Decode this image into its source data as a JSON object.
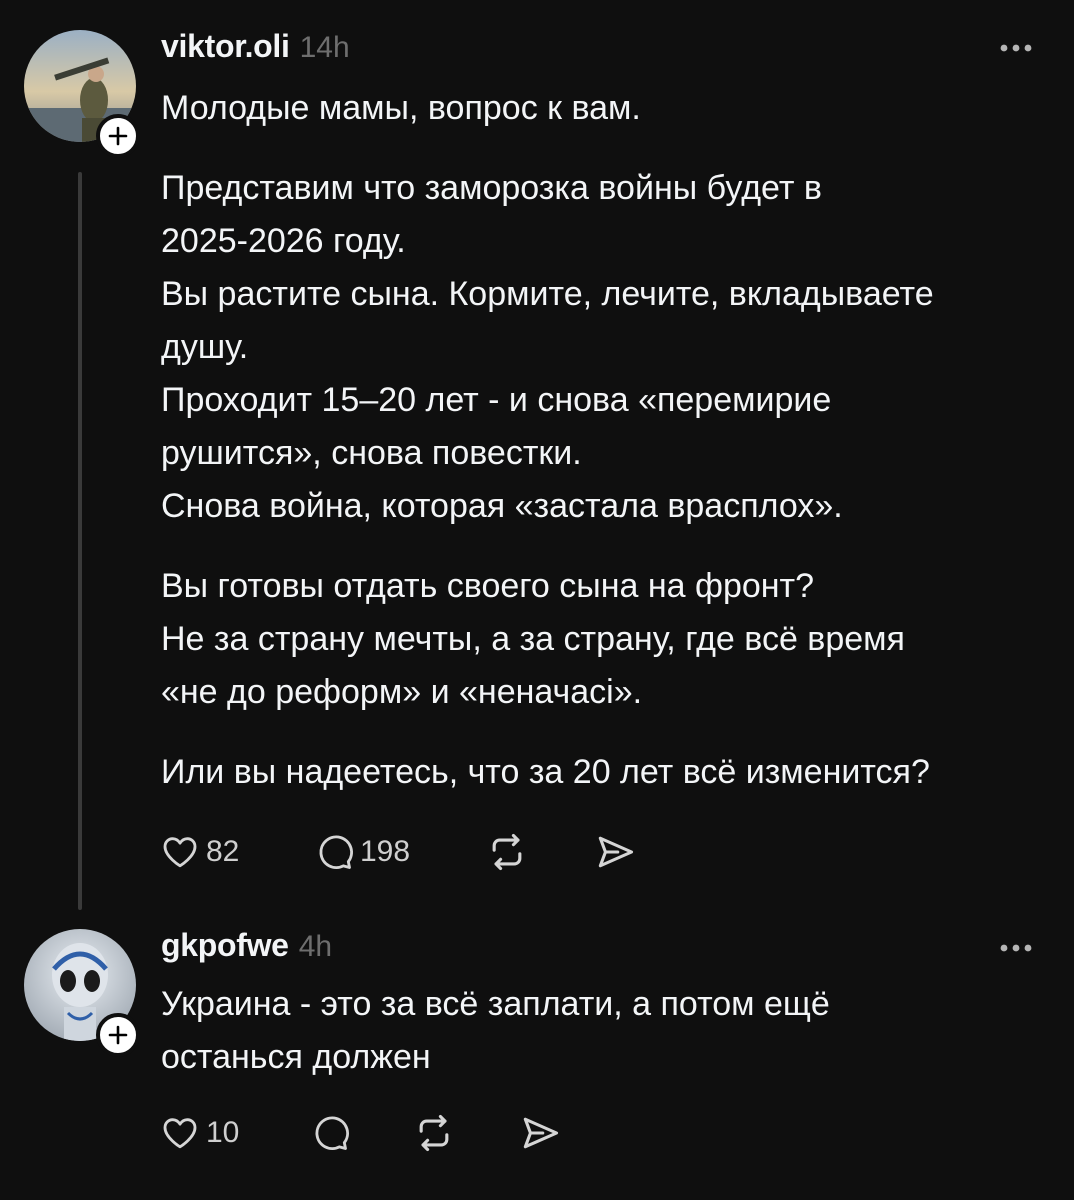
{
  "posts": [
    {
      "username": "viktor.oli",
      "time": "14h",
      "paragraphs": [
        [
          "Молодые мамы, вопрос к вам."
        ],
        [
          "Представим что заморозка войны будет в",
          "2025-2026 году.",
          "Вы растите сына. Кормите, лечите, вкладываете",
          "душу.",
          "Проходит 15–20 лет - и снова «перемирие",
          "рушится», снова повестки.",
          "Снова война, которая «застала врасплох»."
        ],
        [
          "Вы готовы отдать своего сына на фронт?",
          "Не за страну мечты, а за страну, где всё время",
          "«не до реформ» и «неначасі»."
        ],
        [
          "Или вы надеетесь, что за 20 лет всё изменится?"
        ]
      ],
      "likes": "82",
      "replies": "198"
    },
    {
      "username": "gkpofwe",
      "time": "4h",
      "paragraphs": [
        [
          "Украина - это за всё заплати, а потом ещё",
          "останься должен"
        ]
      ],
      "likes": "10",
      "replies": ""
    }
  ],
  "icons": {
    "like": "heart-icon",
    "reply": "comment-icon",
    "repost": "repost-icon",
    "share": "share-icon",
    "more": "more-icon",
    "follow": "plus-icon"
  },
  "colors": {
    "background": "#0f0f0f",
    "text": "#f3f5f7",
    "muted": "#6e6e6e",
    "thread_line": "#3a3a3a"
  }
}
